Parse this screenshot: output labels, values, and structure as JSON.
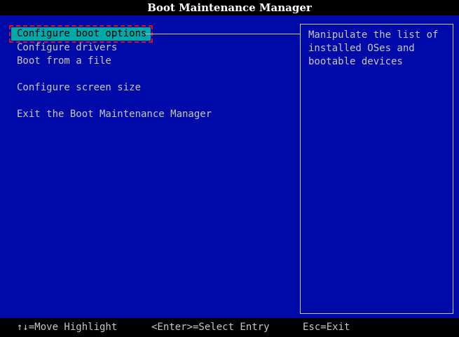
{
  "window": {
    "title": "Boot Maintenance Manager"
  },
  "menu": {
    "items": [
      {
        "label": "Configure boot options",
        "selected": true
      },
      {
        "label": "Configure drivers",
        "selected": false
      },
      {
        "label": "Boot from a file",
        "selected": false
      },
      {
        "label": "Configure screen size",
        "selected": false
      },
      {
        "label": "Exit the Boot Maintenance Manager",
        "selected": false
      }
    ]
  },
  "help": {
    "text": "Manipulate the list of\ninstalled OSes and\nbootable devices"
  },
  "footer": {
    "move": "↑↓=Move Highlight",
    "select": "<Enter>=Select Entry",
    "exit": "Esc=Exit"
  },
  "colors": {
    "background": "#000aa8",
    "highlight": "#00a8a8",
    "text": "#c6c6c6",
    "selection_outline": "#e0101a"
  }
}
